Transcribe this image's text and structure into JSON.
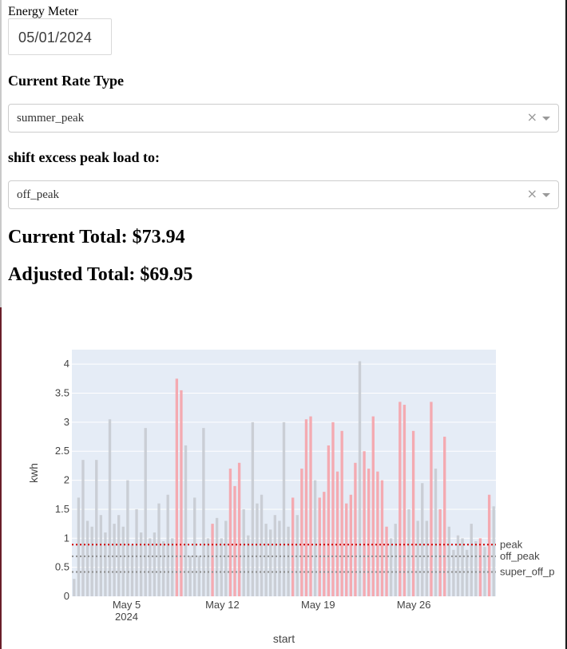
{
  "app": {
    "title": "Energy Meter"
  },
  "date_picker": {
    "value": "05/01/2024"
  },
  "rate_select": {
    "label": "Current Rate Type",
    "value": "summer_peak"
  },
  "shift_select": {
    "label": "shift excess peak load to:",
    "value": "off_peak"
  },
  "totals": {
    "current": "Current Total: $73.94",
    "adjusted": "Adjusted Total: $69.95"
  },
  "icons": {
    "clear": "×"
  },
  "colors": {
    "plot_bg": "#e5ecf6",
    "bar_normal": "#c8ccd3",
    "bar_excess": "#f4a6ad",
    "peak_line": "#d00000",
    "rate_line": "#8c8c8c"
  },
  "chart_data": {
    "type": "bar",
    "title": "",
    "xlabel": "start",
    "ylabel": "kwh",
    "ylim": [
      0,
      4.25
    ],
    "xlim": [
      "2024-05-01",
      "2024-06-01"
    ],
    "y_ticks": [
      "0",
      "0.5",
      "1",
      "1.5",
      "2",
      "2.5",
      "3",
      "3.5",
      "4"
    ],
    "x_ticks": [
      {
        "date": "2024-05-05",
        "label": "May 5",
        "sub": "2024"
      },
      {
        "date": "2024-05-12",
        "label": "May 12",
        "sub": ""
      },
      {
        "date": "2024-05-19",
        "label": "May 19",
        "sub": ""
      },
      {
        "date": "2024-05-26",
        "label": "May 26",
        "sub": ""
      }
    ],
    "hlines": [
      {
        "name": "peak",
        "y": 0.89,
        "color": "#d00000"
      },
      {
        "name": "off_peak",
        "y": 0.69,
        "color": "#8c8c8c"
      },
      {
        "name": "super_off_p",
        "y": 0.42,
        "color": "#8c8c8c"
      }
    ],
    "series": [
      {
        "name": "kwh",
        "values": [
          0.3,
          1.7,
          2.35,
          1.3,
          1.2,
          2.35,
          1.4,
          1.1,
          3.05,
          1.25,
          1.4,
          1.2,
          2.0,
          0.9,
          1.5,
          1.1,
          2.9,
          1.0,
          1.1,
          1.6,
          0.95,
          1.75,
          1.0,
          3.75,
          3.55,
          2.6,
          0.7,
          1.7,
          0.7,
          2.9,
          1.0,
          1.25,
          1.35,
          1.0,
          1.3,
          2.2,
          1.9,
          2.3,
          1.5,
          1.05,
          3.0,
          1.6,
          1.75,
          1.25,
          1.15,
          1.4,
          1.3,
          3.0,
          1.2,
          1.7,
          1.4,
          2.2,
          3.05,
          3.1,
          2.0,
          1.7,
          1.8,
          2.6,
          3.0,
          2.15,
          2.85,
          1.6,
          1.75,
          2.3,
          4.05,
          2.5,
          2.2,
          3.1,
          2.15,
          2.0,
          1.2,
          1.0,
          1.25,
          3.35,
          3.3,
          1.5,
          2.85,
          1.3,
          1.95,
          1.3,
          3.35,
          2.2,
          1.5,
          2.75,
          1.2,
          0.8,
          1.05,
          1.0,
          0.8,
          1.25,
          0.95,
          1.0,
          0.85,
          1.75,
          1.55
        ],
        "excess": [
          false,
          false,
          false,
          false,
          false,
          false,
          false,
          false,
          false,
          false,
          false,
          false,
          false,
          false,
          false,
          false,
          false,
          false,
          false,
          false,
          false,
          false,
          false,
          true,
          true,
          false,
          false,
          false,
          false,
          false,
          false,
          true,
          false,
          false,
          false,
          true,
          true,
          true,
          false,
          false,
          false,
          false,
          false,
          false,
          false,
          false,
          false,
          false,
          false,
          true,
          false,
          true,
          true,
          true,
          false,
          true,
          true,
          true,
          true,
          true,
          true,
          true,
          true,
          true,
          false,
          true,
          true,
          true,
          true,
          true,
          true,
          false,
          false,
          true,
          true,
          false,
          true,
          false,
          false,
          false,
          true,
          false,
          true,
          true,
          false,
          false,
          false,
          false,
          false,
          false,
          false,
          true,
          false,
          true,
          false
        ]
      }
    ]
  }
}
